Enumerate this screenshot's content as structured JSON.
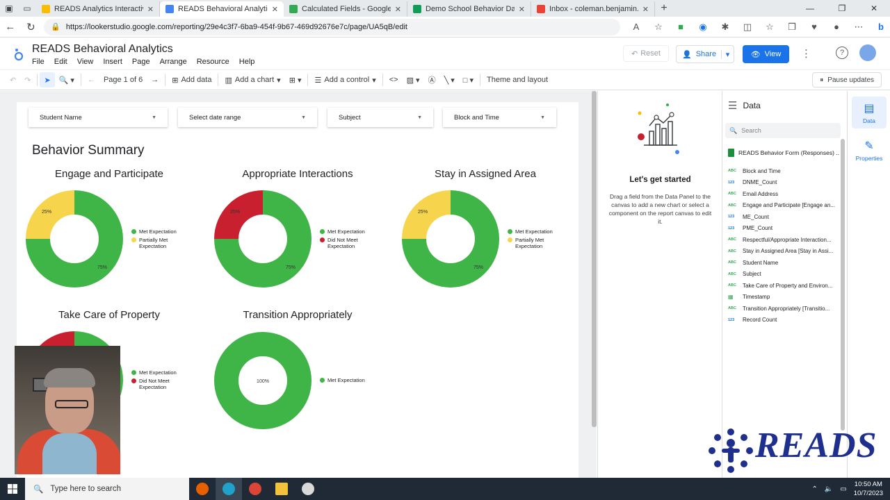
{
  "browser": {
    "tabs": [
      {
        "label": "READS Analytics Interactive Broc",
        "color": "#fbbc04",
        "active": false
      },
      {
        "label": "READS Behavioral Analytics - Beh",
        "color": "#4285f4",
        "active": true
      },
      {
        "label": "Calculated Fields - Google Drive",
        "color": "#34a853",
        "active": false
      },
      {
        "label": "Demo School Behavior Daily Calc",
        "color": "#0f9d58",
        "active": false
      },
      {
        "label": "Inbox - coleman.benjamin.j@gm",
        "color": "#ea4335",
        "active": false
      }
    ],
    "url": "https://lookerstudio.google.com/reporting/29e4c3f7-6ba9-454f-9b67-469d92676e7c/page/UA5qB/edit"
  },
  "header": {
    "title": "READS Behavioral Analytics",
    "menu": [
      "File",
      "Edit",
      "View",
      "Insert",
      "Page",
      "Arrange",
      "Resource",
      "Help"
    ],
    "reset_label": "Reset",
    "share_label": "Share",
    "view_label": "View"
  },
  "toolbar": {
    "page_label": "Page 1 of 6",
    "add_data": "Add data",
    "add_chart": "Add a chart",
    "add_control": "Add a control",
    "theme_layout": "Theme and layout",
    "pause_updates": "Pause updates"
  },
  "filters": [
    "Student Name",
    "Select date range",
    "Subject",
    "Block and Time"
  ],
  "report": {
    "section_title": "Behavior Summary",
    "legend_labels": {
      "met": "Met Expectation",
      "partial": "Partially Met Expectation",
      "not_met": "Did Not Meet Expectation"
    }
  },
  "chart_data": [
    {
      "type": "pie",
      "title": "Engage and Participate",
      "categories": [
        "Met Expectation",
        "Partially Met Expectation"
      ],
      "values": [
        75,
        25
      ],
      "slice_labels": [
        "75%",
        "25%"
      ],
      "colors": [
        "#3fb447",
        "#f6d44b"
      ],
      "legend": "right"
    },
    {
      "type": "pie",
      "title": "Appropriate Interactions",
      "categories": [
        "Met Expectation",
        "Did Not Meet Expectation"
      ],
      "values": [
        75,
        25
      ],
      "slice_labels": [
        "75%",
        "25%"
      ],
      "colors": [
        "#3fb447",
        "#c8202f"
      ],
      "legend": "right"
    },
    {
      "type": "pie",
      "title": "Stay in Assigned Area",
      "categories": [
        "Met Expectation",
        "Partially Met Expectation"
      ],
      "values": [
        75,
        25
      ],
      "slice_labels": [
        "75%",
        "25%"
      ],
      "colors": [
        "#3fb447",
        "#f6d44b"
      ],
      "legend": "right"
    },
    {
      "type": "pie",
      "title": "Take Care of Property",
      "categories": [
        "Met Expectation",
        "Did Not Meet Expectation"
      ],
      "values": [
        75,
        25
      ],
      "slice_labels": [
        "",
        ""
      ],
      "colors": [
        "#3fb447",
        "#c8202f"
      ],
      "legend": "right"
    },
    {
      "type": "pie",
      "title": "Transition Appropriately",
      "categories": [
        "Met Expectation"
      ],
      "values": [
        100
      ],
      "slice_labels": [
        "100%"
      ],
      "colors": [
        "#3fb447"
      ],
      "legend": "right"
    }
  ],
  "start_panel": {
    "title": "Let's get started",
    "description": "Drag a field from the Data Panel to the canvas to add a new chart or select a component on the report canvas to edit it."
  },
  "data_panel": {
    "title": "Data",
    "search_placeholder": "Search",
    "source": "READS Behavior Form (Responses) ...",
    "fields": [
      {
        "type": "ABC",
        "name": "Block and Time"
      },
      {
        "type": "123",
        "name": "DNME_Count"
      },
      {
        "type": "ABC",
        "name": "Email Address"
      },
      {
        "type": "ABC",
        "name": "Engage and Participate [Engage an..."
      },
      {
        "type": "123",
        "name": "ME_Count"
      },
      {
        "type": "123",
        "name": "PME_Count"
      },
      {
        "type": "ABC",
        "name": "Respectful/Appropriate Interaction..."
      },
      {
        "type": "ABC",
        "name": "Stay in Assigned Area [Stay in Assi..."
      },
      {
        "type": "ABC",
        "name": "Student Name"
      },
      {
        "type": "ABC",
        "name": "Subject"
      },
      {
        "type": "ABC",
        "name": "Take Care of Property and Environ..."
      },
      {
        "type": "CAL",
        "name": "Timestamp"
      },
      {
        "type": "ABC",
        "name": "Transition Appropriately [Transitio..."
      },
      {
        "type": "123",
        "name": "Record Count"
      }
    ]
  },
  "side_tabs": {
    "data": "Data",
    "properties": "Properties"
  },
  "watermark": "READS",
  "taskbar": {
    "search_placeholder": "Type here to search",
    "time": "10:50 AM",
    "date": "10/7/2023"
  }
}
